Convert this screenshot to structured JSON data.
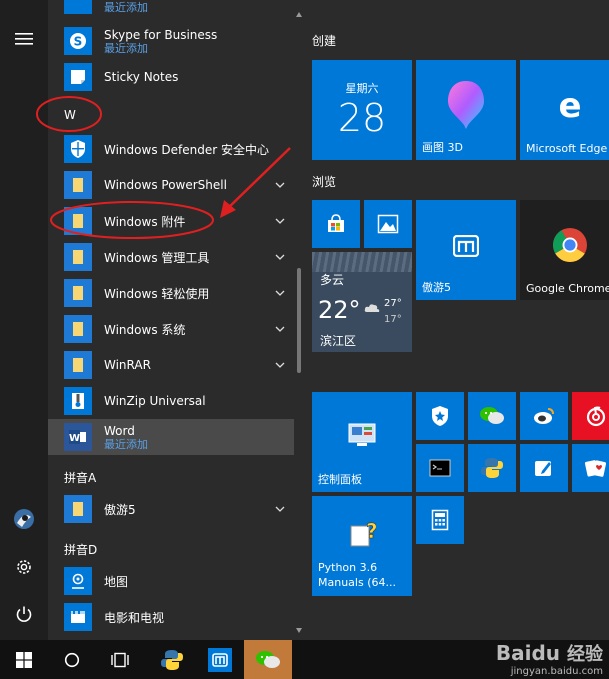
{
  "rail": {
    "buttons": [
      {
        "name": "menu-icon"
      },
      {
        "name": "user-avatar"
      },
      {
        "name": "settings-icon"
      },
      {
        "name": "power-icon"
      }
    ]
  },
  "applist": {
    "top_partial_sub": "最近添加",
    "items": [
      {
        "name": "Skype for Business",
        "sub": "最近添加",
        "icon": "skype-icon"
      },
      {
        "name": "Sticky Notes",
        "sub": "",
        "icon": "sticky-notes-icon"
      },
      {
        "name": "Windows Defender 安全中心",
        "sub": "",
        "icon": "shield-icon"
      },
      {
        "name": "Windows PowerShell",
        "sub": "",
        "icon": "folder-icon",
        "expandable": true
      },
      {
        "name": "Windows 附件",
        "sub": "",
        "icon": "folder-icon",
        "expandable": true
      },
      {
        "name": "Windows 管理工具",
        "sub": "",
        "icon": "folder-icon",
        "expandable": true
      },
      {
        "name": "Windows 轻松使用",
        "sub": "",
        "icon": "folder-icon",
        "expandable": true
      },
      {
        "name": "Windows 系统",
        "sub": "",
        "icon": "folder-icon",
        "expandable": true
      },
      {
        "name": "WinRAR",
        "sub": "",
        "icon": "folder-icon",
        "expandable": true
      },
      {
        "name": "WinZip Universal",
        "sub": "",
        "icon": "winzip-icon"
      },
      {
        "name": "Word",
        "sub": "最近添加",
        "icon": "word-icon"
      },
      {
        "name": "傲游5",
        "sub": "",
        "icon": "folder-icon",
        "expandable": true
      },
      {
        "name": "地图",
        "sub": "",
        "icon": "map-icon"
      },
      {
        "name": "电影和电视",
        "sub": "",
        "icon": "movies-icon"
      }
    ],
    "sections": {
      "w": "W",
      "pinyin_a": "拼音A",
      "pinyin_d": "拼音D"
    }
  },
  "tiles": {
    "groups": {
      "create": "创建",
      "browse": "浏览"
    },
    "calendar": {
      "weekday": "星期六",
      "day": "28"
    },
    "paint3d": "画图 3D",
    "edge": "Microsoft Edge",
    "maxthon": "傲游5",
    "chrome": "Google Chrome",
    "weather": {
      "condition": "多云",
      "temp": "22°",
      "high": "27°",
      "low": "17°",
      "city": "滨江区"
    },
    "control_panel": "控制面板",
    "python": "Python 3.6 Manuals (64..."
  },
  "colors": {
    "accent": "#0078d7",
    "background": "#2b2b2b",
    "annotation": "#e02020"
  },
  "watermark": {
    "site": "jingyan.baidu.com",
    "logo_text": "Baidu 经验"
  }
}
